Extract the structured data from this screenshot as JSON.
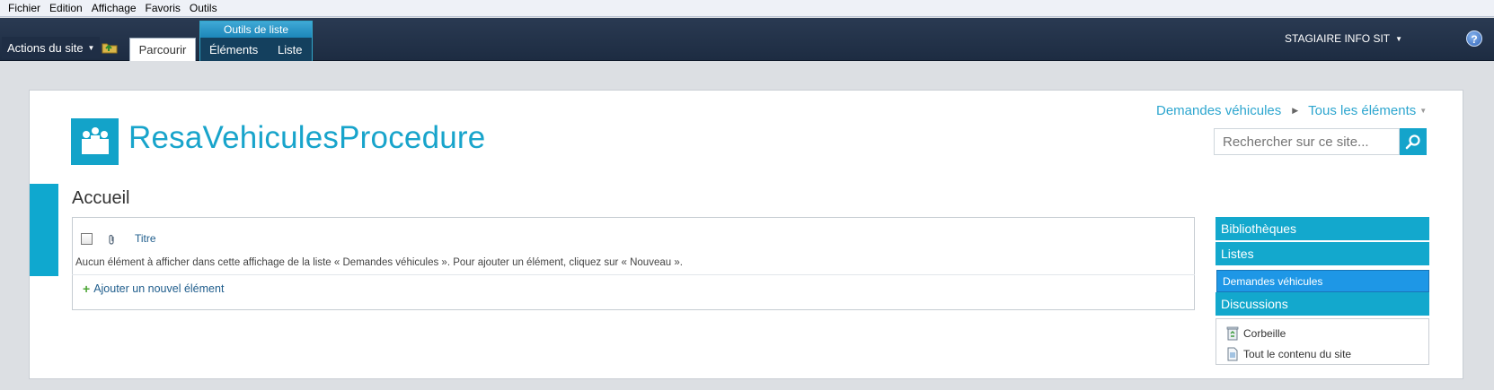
{
  "menubar": {
    "items": [
      "Fichier",
      "Edition",
      "Affichage",
      "Favoris",
      "Outils"
    ]
  },
  "ribbon": {
    "site_actions": "Actions du site",
    "tab_browse": "Parcourir",
    "context_group": "Outils de liste",
    "context_tabs": [
      "Éléments",
      "Liste"
    ],
    "user": "STAGIAIRE INFO SIT",
    "help": "?"
  },
  "site": {
    "title": "ResaVehiculesProcedure"
  },
  "breadcrumb": {
    "list": "Demandes véhicules",
    "view": "Tous les éléments"
  },
  "search": {
    "placeholder": "Rechercher sur ce site..."
  },
  "page": {
    "title": "Accueil"
  },
  "list": {
    "column_title": "Titre",
    "empty_message": "Aucun élément à afficher dans cette affichage de la liste « Demandes véhicules ». Pour ajouter un élément, cliquez sur « Nouveau ».",
    "add_item": "Ajouter un nouvel élément"
  },
  "quick_launch": {
    "libraries": "Bibliothèques",
    "lists": "Listes",
    "lists_item": "Demandes véhicules",
    "discussions": "Discussions",
    "recycle_bin": "Corbeille",
    "all_content": "Tout le contenu du site"
  },
  "colors": {
    "accent": "#13a8cd",
    "ribbon": "#1d2c42",
    "selected": "#1e97e6",
    "link": "#1f5d8c"
  }
}
